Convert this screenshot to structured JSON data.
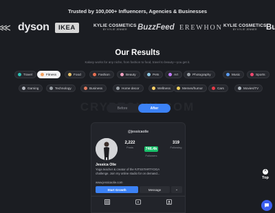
{
  "header": {
    "trusted_text": "Trusted by 100,000+ Influencers, Agencies & Businesses"
  },
  "logos": {
    "arrow": "⋘",
    "dyson": "dyson",
    "ikea": "IKEA",
    "kylie_main": "KYLIE COSMETICS",
    "kylie_sub": "BY KYLIE JENNER",
    "buzzfeed": "BuzzFeed",
    "erewhon": "EREWHON",
    "partial": "Bu"
  },
  "results": {
    "title": "Our Results",
    "subtitle": "Kalasy works for any niche, from fashion to food, travel to beauty—you get it."
  },
  "categories": {
    "row1": [
      "Travel",
      "Fitness",
      "Food",
      "Fashion",
      "Beauty",
      "Pets",
      "Art",
      "Photography",
      "Music",
      "Sports"
    ],
    "row2": [
      "Gaming",
      "Technology",
      "Business",
      "Home decor",
      "Wellness",
      "Memes/humor",
      "Cars",
      "Movies/TV"
    ],
    "active": "Fitness"
  },
  "toggle": {
    "before": "Before",
    "after": "After"
  },
  "watermark": "CRYPTOWH.COM",
  "profile": {
    "handle": "@jessicaolie",
    "posts_value": "2,222",
    "posts_label": "Posts",
    "followers_value": "746.4k",
    "followers_label": "Followers",
    "following_value": "319",
    "following_label": "Following",
    "name": "Jessica Olie",
    "bio_line1": "Yoga teacher & creator of the #JTSSTARTYOGA",
    "bio_line2": "challenge. Join my online studio for on demand...",
    "website": "www.jessicaolie.com",
    "start_button": "Start Growth",
    "message_button": "Message",
    "more_button": "⌄"
  },
  "scroll_top": {
    "arrow": "^",
    "label": "Top"
  },
  "colors": {
    "background": "#1b1d22",
    "accent": "#3c82f6",
    "followers_badge": "#19c06a",
    "chat": "#3c5ff0"
  }
}
